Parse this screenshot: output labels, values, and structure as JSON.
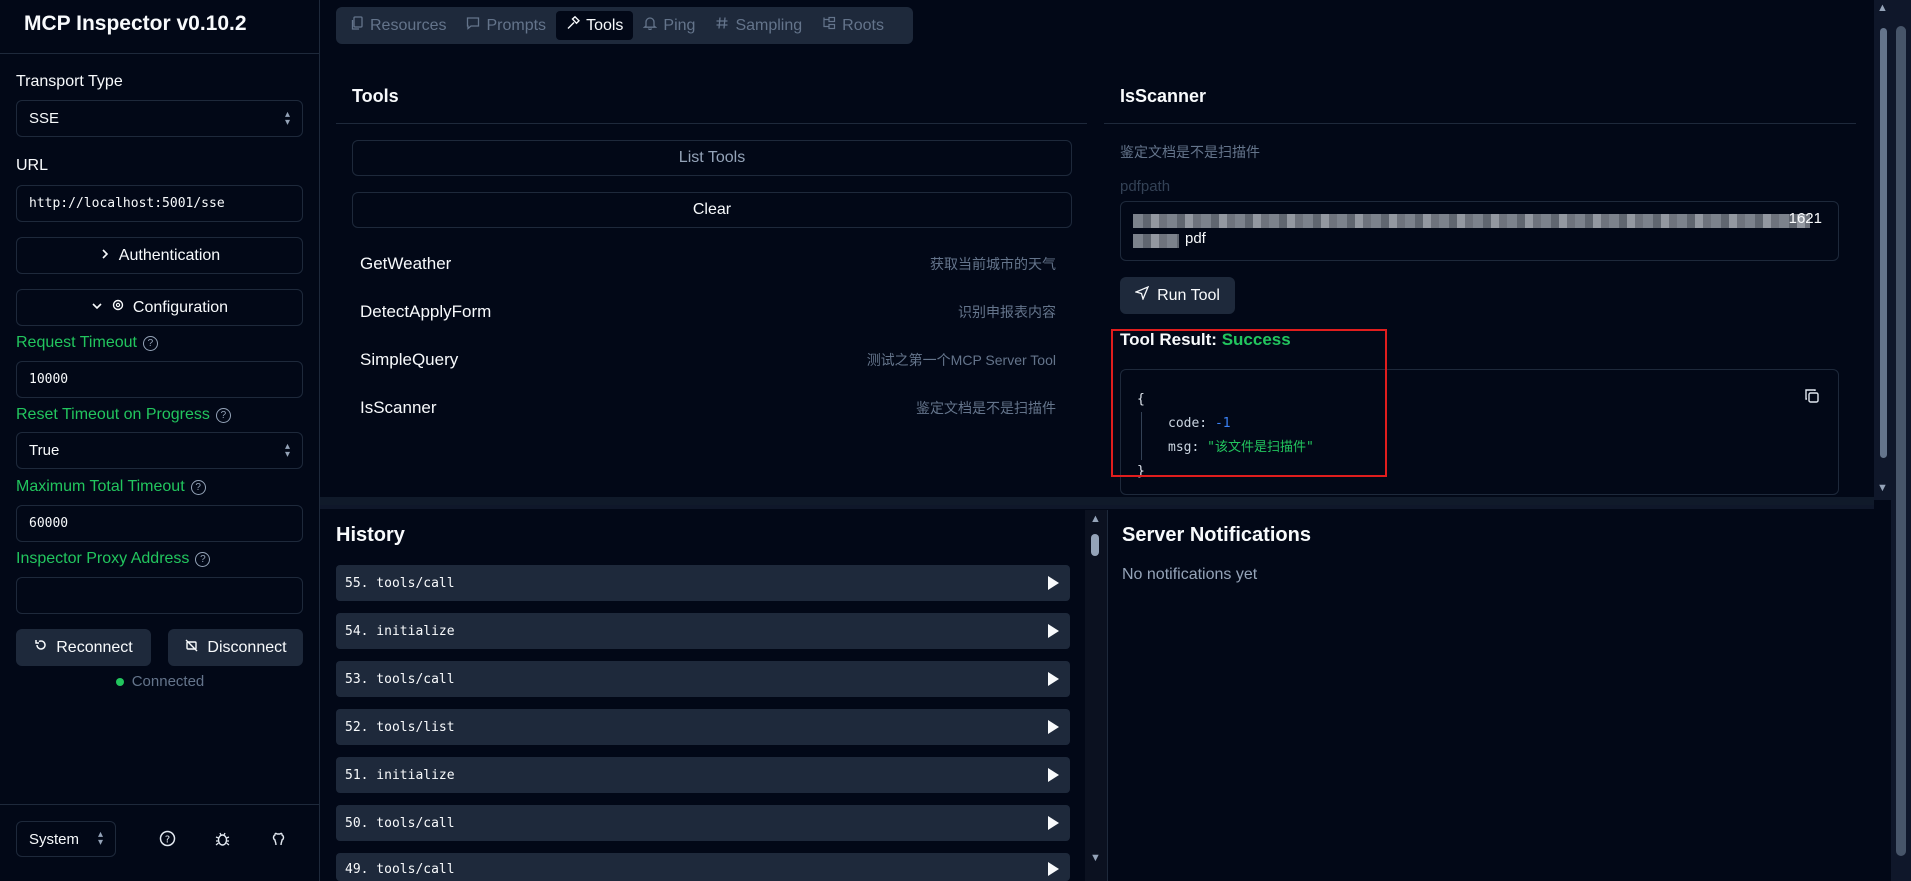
{
  "app": {
    "title": "MCP Inspector v0.10.2"
  },
  "sidebar": {
    "transport_label": "Transport Type",
    "transport_value": "SSE",
    "url_label": "URL",
    "url_value": "http://localhost:5001/sse",
    "auth_label": "Authentication",
    "config_label": "Configuration",
    "request_timeout_label": "Request Timeout",
    "request_timeout_value": "10000",
    "reset_timeout_label": "Reset Timeout on Progress",
    "reset_timeout_value": "True",
    "max_timeout_label": "Maximum Total Timeout",
    "max_timeout_value": "60000",
    "proxy_label": "Inspector Proxy Address",
    "proxy_value": "",
    "reconnect_label": "Reconnect",
    "disconnect_label": "Disconnect",
    "status": "Connected",
    "theme": "System",
    "accent_color": "#22c55e"
  },
  "tabs": [
    "Resources",
    "Prompts",
    "Tools",
    "Ping",
    "Sampling",
    "Roots"
  ],
  "active_tab": "Tools",
  "tools_panel": {
    "title": "Tools",
    "list_button": "List Tools",
    "clear_button": "Clear",
    "items": [
      {
        "name": "GetWeather",
        "desc": "获取当前城市的天气"
      },
      {
        "name": "DetectApplyForm",
        "desc": "识别申报表内容"
      },
      {
        "name": "SimpleQuery",
        "desc": "测试之第一个MCP Server Tool"
      },
      {
        "name": "IsScanner",
        "desc": "鉴定文档是不是扫描件"
      }
    ]
  },
  "tool_detail": {
    "title": "IsScanner",
    "description": "鉴定文档是不是扫描件",
    "param_label": "pdfpath",
    "param_value_line1_tail": "1621",
    "param_value_line2_tail": "pdf",
    "run_button": "Run Tool",
    "result_label": "Tool Result:",
    "result_status": "Success",
    "result": {
      "open": "{",
      "close": "}",
      "code_key": "code:",
      "code_val": "-1",
      "msg_key": "msg:",
      "msg_val": "\"该文件是扫描件\""
    }
  },
  "history": {
    "title": "History",
    "items": [
      "55. tools/call",
      "54. initialize",
      "53. tools/call",
      "52. tools/list",
      "51. initialize",
      "50. tools/call",
      "49. tools/call"
    ]
  },
  "notifications": {
    "title": "Server Notifications",
    "empty": "No notifications yet"
  }
}
